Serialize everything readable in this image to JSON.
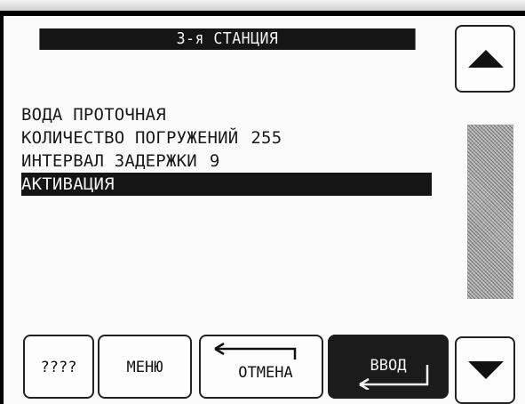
{
  "title": "3-я СТАНЦИЯ",
  "menu": {
    "items": [
      {
        "label": "ВОДА ПРОТОЧНАЯ",
        "value": ""
      },
      {
        "label": "КОЛИЧЕСТВО ПОГРУЖЕНИЙ",
        "value": "255"
      },
      {
        "label": "ИНТЕРВАЛ ЗАДЕРЖКИ",
        "value": "9"
      },
      {
        "label": "АКТИВАЦИЯ",
        "value": ""
      }
    ],
    "selected_index": 3
  },
  "buttons": {
    "help": "????",
    "menu": "МЕНЮ",
    "cancel": "ОТМЕНА",
    "enter": "ВВОД"
  },
  "icons": {
    "scroll_up": "up-triangle-icon",
    "scroll_down": "down-triangle-icon",
    "cancel": "return-arrow-icon",
    "enter": "enter-arrow-icon"
  },
  "colors": {
    "foreground": "#151515",
    "background": "#fbfbfb",
    "scroll_track": "#b0b0b0"
  }
}
